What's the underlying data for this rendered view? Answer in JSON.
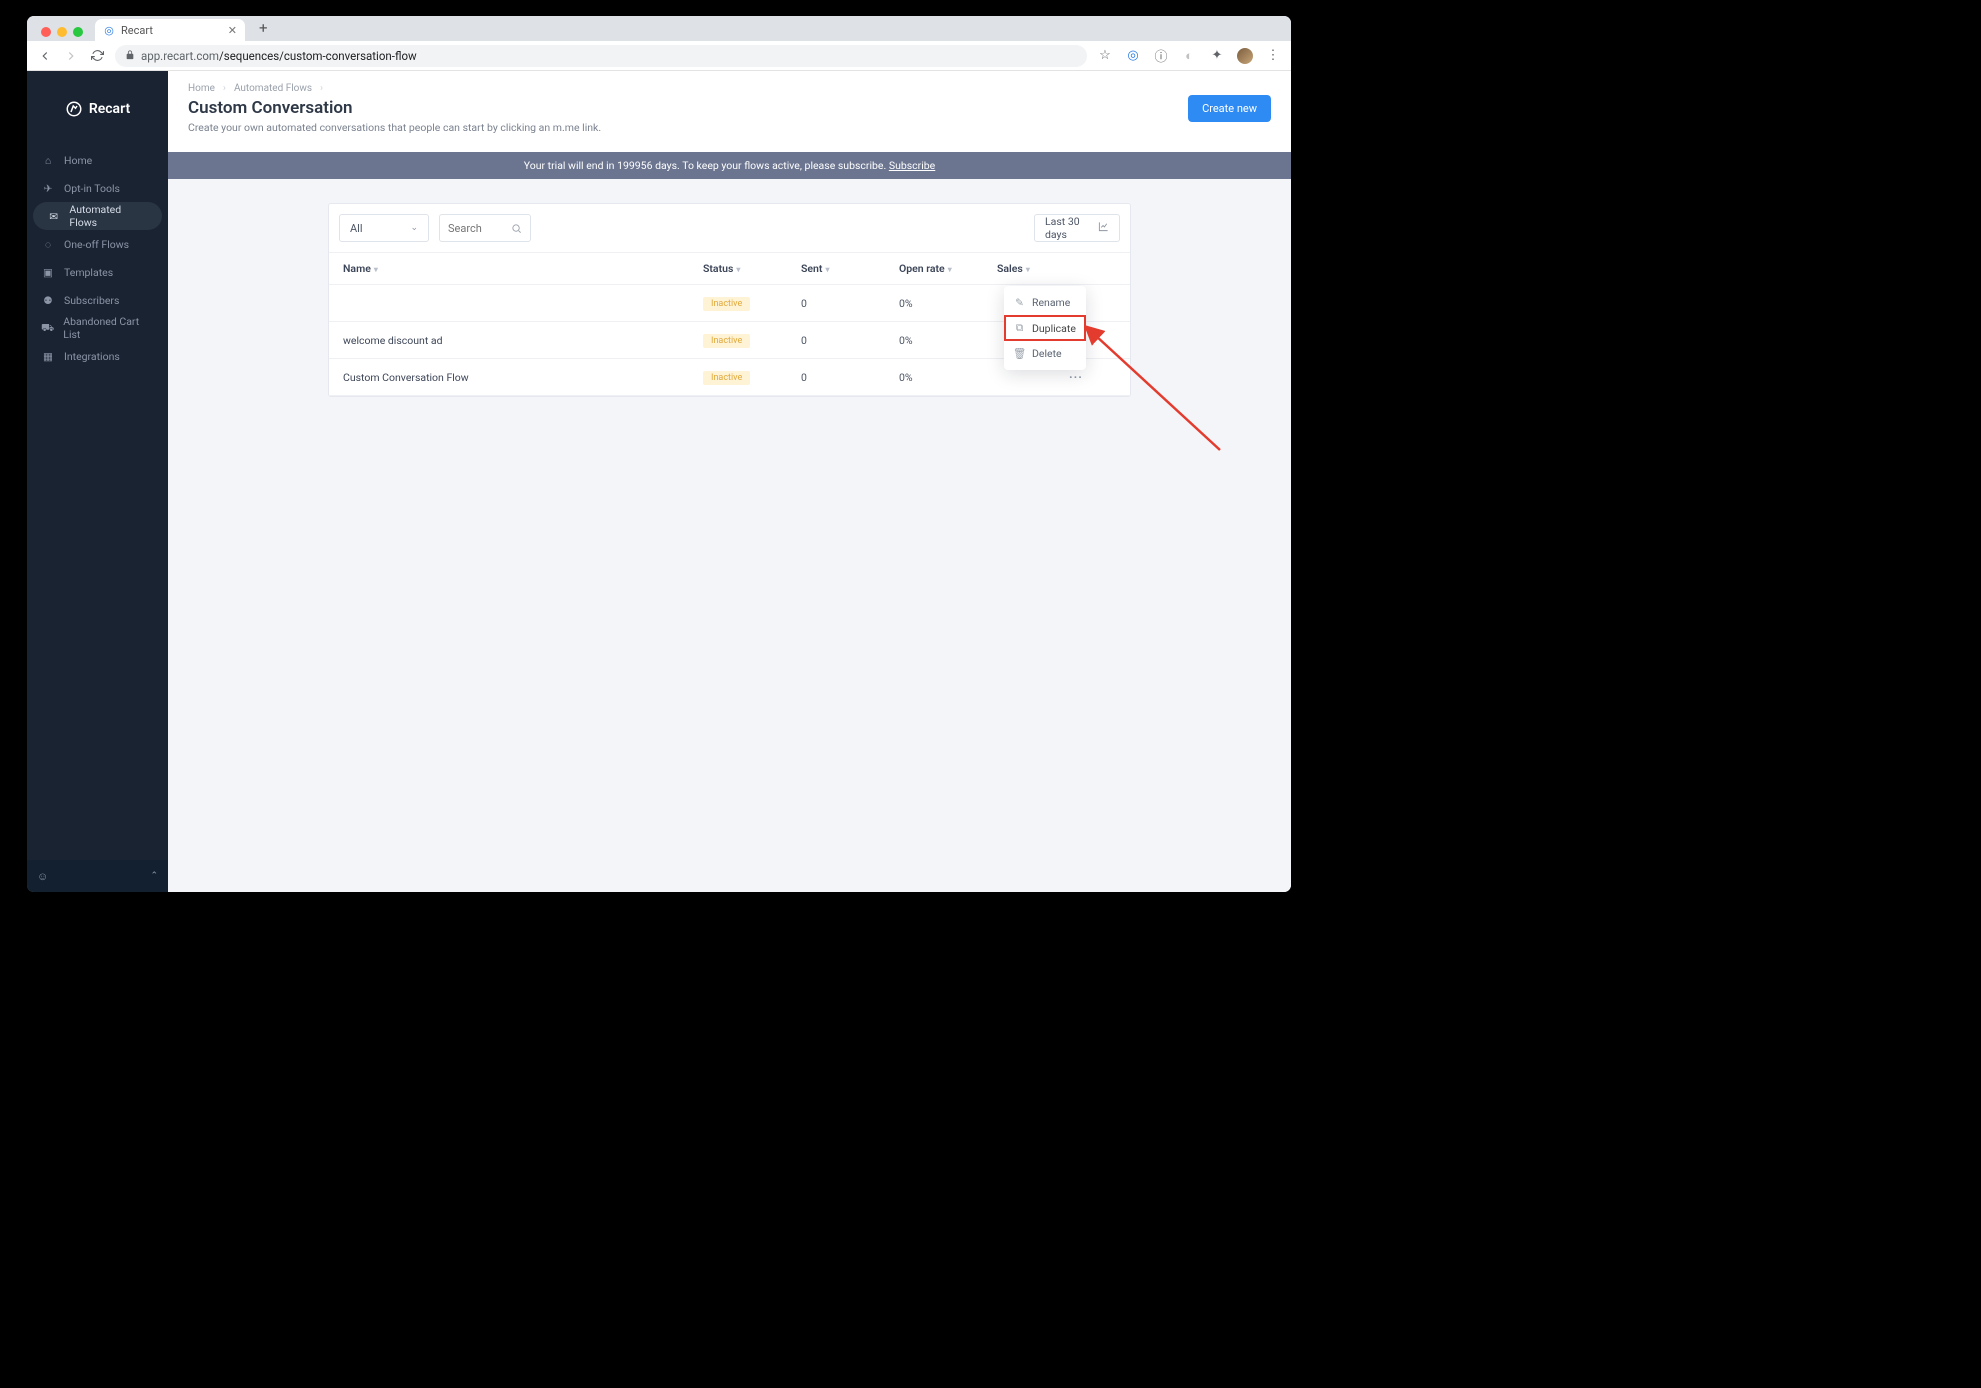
{
  "browser": {
    "tab_title": "Recart",
    "url_display": "app.recart.com",
    "url_path": "/sequences/custom-conversation-flow"
  },
  "brand": "Recart",
  "sidebar": {
    "items": [
      {
        "label": "Home"
      },
      {
        "label": "Opt-in Tools"
      },
      {
        "label": "Automated Flows"
      },
      {
        "label": "One-off Flows"
      },
      {
        "label": "Templates"
      },
      {
        "label": "Subscribers"
      },
      {
        "label": "Abandoned Cart List"
      },
      {
        "label": "Integrations"
      }
    ],
    "active_index": 2
  },
  "breadcrumb": [
    "Home",
    "Automated Flows"
  ],
  "page": {
    "title": "Custom Conversation",
    "subtitle": "Create your own automated conversations that people can start by clicking an m.me link.",
    "create_btn": "Create new"
  },
  "banner": {
    "prefix": "Your trial will end in 199956 days. To keep your flows active, please subscribe. ",
    "link": "Subscribe"
  },
  "filters": {
    "all_label": "All",
    "search_placeholder": "Search",
    "range_label": "Last 30 days"
  },
  "columns": {
    "name": "Name",
    "status": "Status",
    "sent": "Sent",
    "open": "Open rate",
    "sales": "Sales"
  },
  "rows": [
    {
      "name": "",
      "status": "Inactive",
      "sent": "0",
      "open": "0%",
      "sales": ""
    },
    {
      "name": "welcome discount ad",
      "status": "Inactive",
      "sent": "0",
      "open": "0%",
      "sales": ""
    },
    {
      "name": "Custom Conversation Flow",
      "status": "Inactive",
      "sent": "0",
      "open": "0%",
      "sales": ""
    }
  ],
  "context_menu": {
    "items": [
      {
        "label": "Rename"
      },
      {
        "label": "Duplicate"
      },
      {
        "label": "Delete"
      }
    ],
    "highlight_index": 1
  }
}
